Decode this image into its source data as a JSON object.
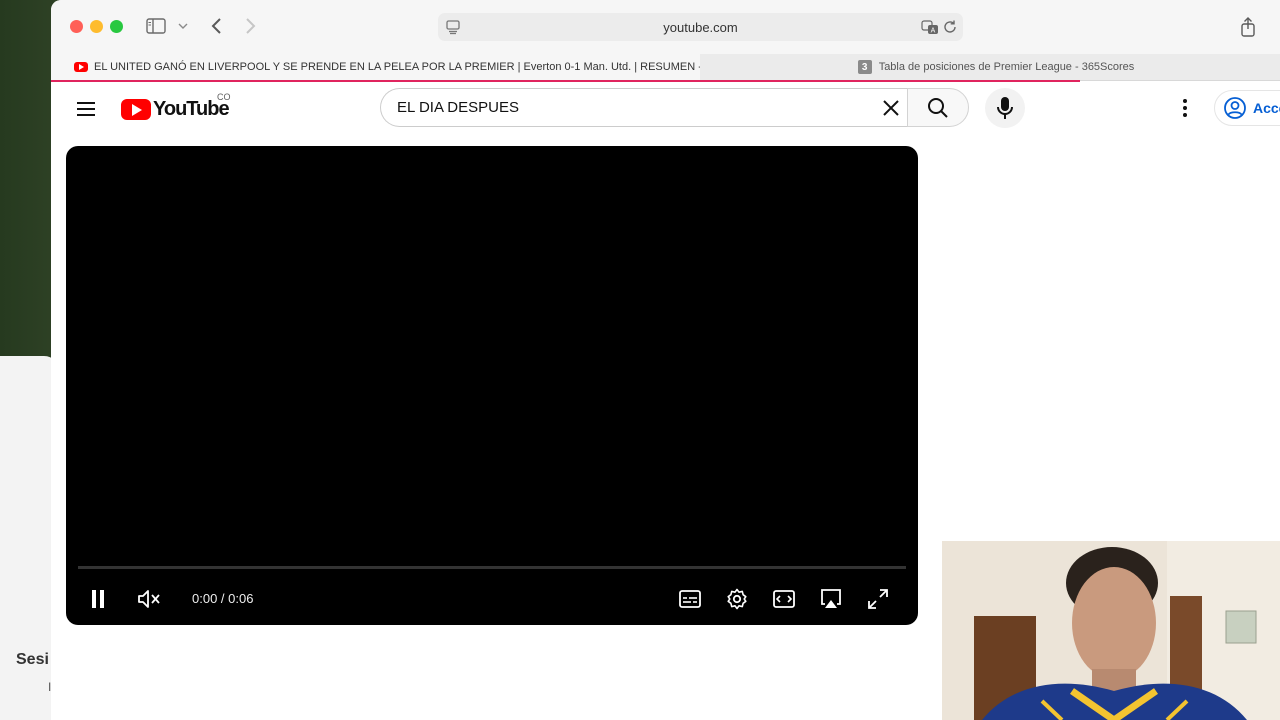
{
  "desktop": {
    "panel_text": "Sesi",
    "panel_text2": "I"
  },
  "browser": {
    "url": "youtube.com",
    "tabs": [
      {
        "label": "EL UNITED GANÓ EN LIVERPOOL Y SE PRENDE EN LA PELEA POR LA PREMIER | Everton 0-1 Man. Utd. | RESUMEN -...",
        "active": true
      },
      {
        "label": "Tabla de posiciones de Premier League - 365Scores",
        "favicon_text": "3",
        "active": false
      }
    ],
    "load_progress": 0.83
  },
  "youtube": {
    "logo_text": "YouTube",
    "country_code": "CO",
    "search_value": "EL DIA DESPUES",
    "signin_label": "Acceder",
    "colors": {
      "brand": "#ff0000",
      "link": "#065fd4"
    }
  },
  "player": {
    "time_current": "0:00",
    "time_total": "0:06",
    "time_separator": " / ",
    "progress": 0.0,
    "state": "playing",
    "muted": true
  }
}
